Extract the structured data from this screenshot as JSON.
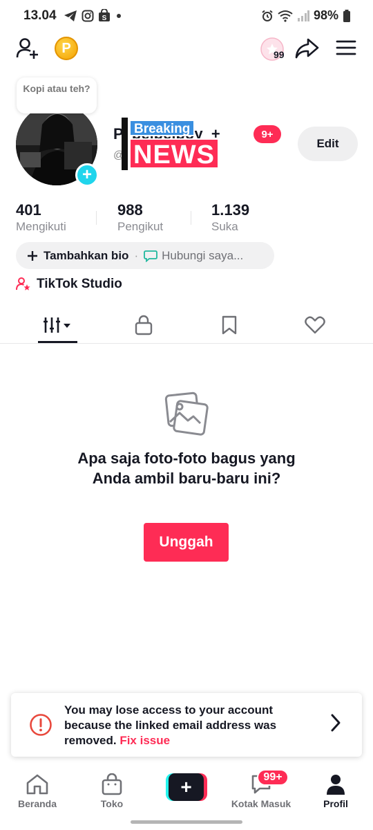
{
  "status_bar": {
    "time": "13.04",
    "battery": "98%"
  },
  "top_bar": {
    "points_symbol": "P",
    "coins_count": "99"
  },
  "profile": {
    "bubble_text": "Kopi atau teh?",
    "username": "Pi beibeiboy_+",
    "handle": "@",
    "overlay_breaking": "Breaking",
    "overlay_news": "NEWS",
    "notification_badge": "9+",
    "edit_label": "Edit"
  },
  "stats": [
    {
      "value": "401",
      "label": "Mengikuti"
    },
    {
      "value": "988",
      "label": "Pengikut"
    },
    {
      "value": "1.139",
      "label": "Suka"
    }
  ],
  "bio": {
    "add_label": "Tambahkan bio",
    "separator": "·",
    "contact_label": "Hubungi saya..."
  },
  "studio": {
    "label": "TikTok Studio"
  },
  "empty_state": {
    "message": "Apa saja foto-foto bagus yang Anda ambil baru-baru ini?",
    "upload_label": "Unggah"
  },
  "alert": {
    "message": "You may lose access to your account because the linked email address was removed.",
    "link": "Fix issue"
  },
  "bottom_nav": {
    "home": "Beranda",
    "shop": "Toko",
    "inbox": "Kotak Masuk",
    "inbox_badge": "99+",
    "profile": "Profil"
  },
  "colors": {
    "accent": "#fe2c55",
    "cyan": "#25f4ee",
    "text": "#161823"
  }
}
